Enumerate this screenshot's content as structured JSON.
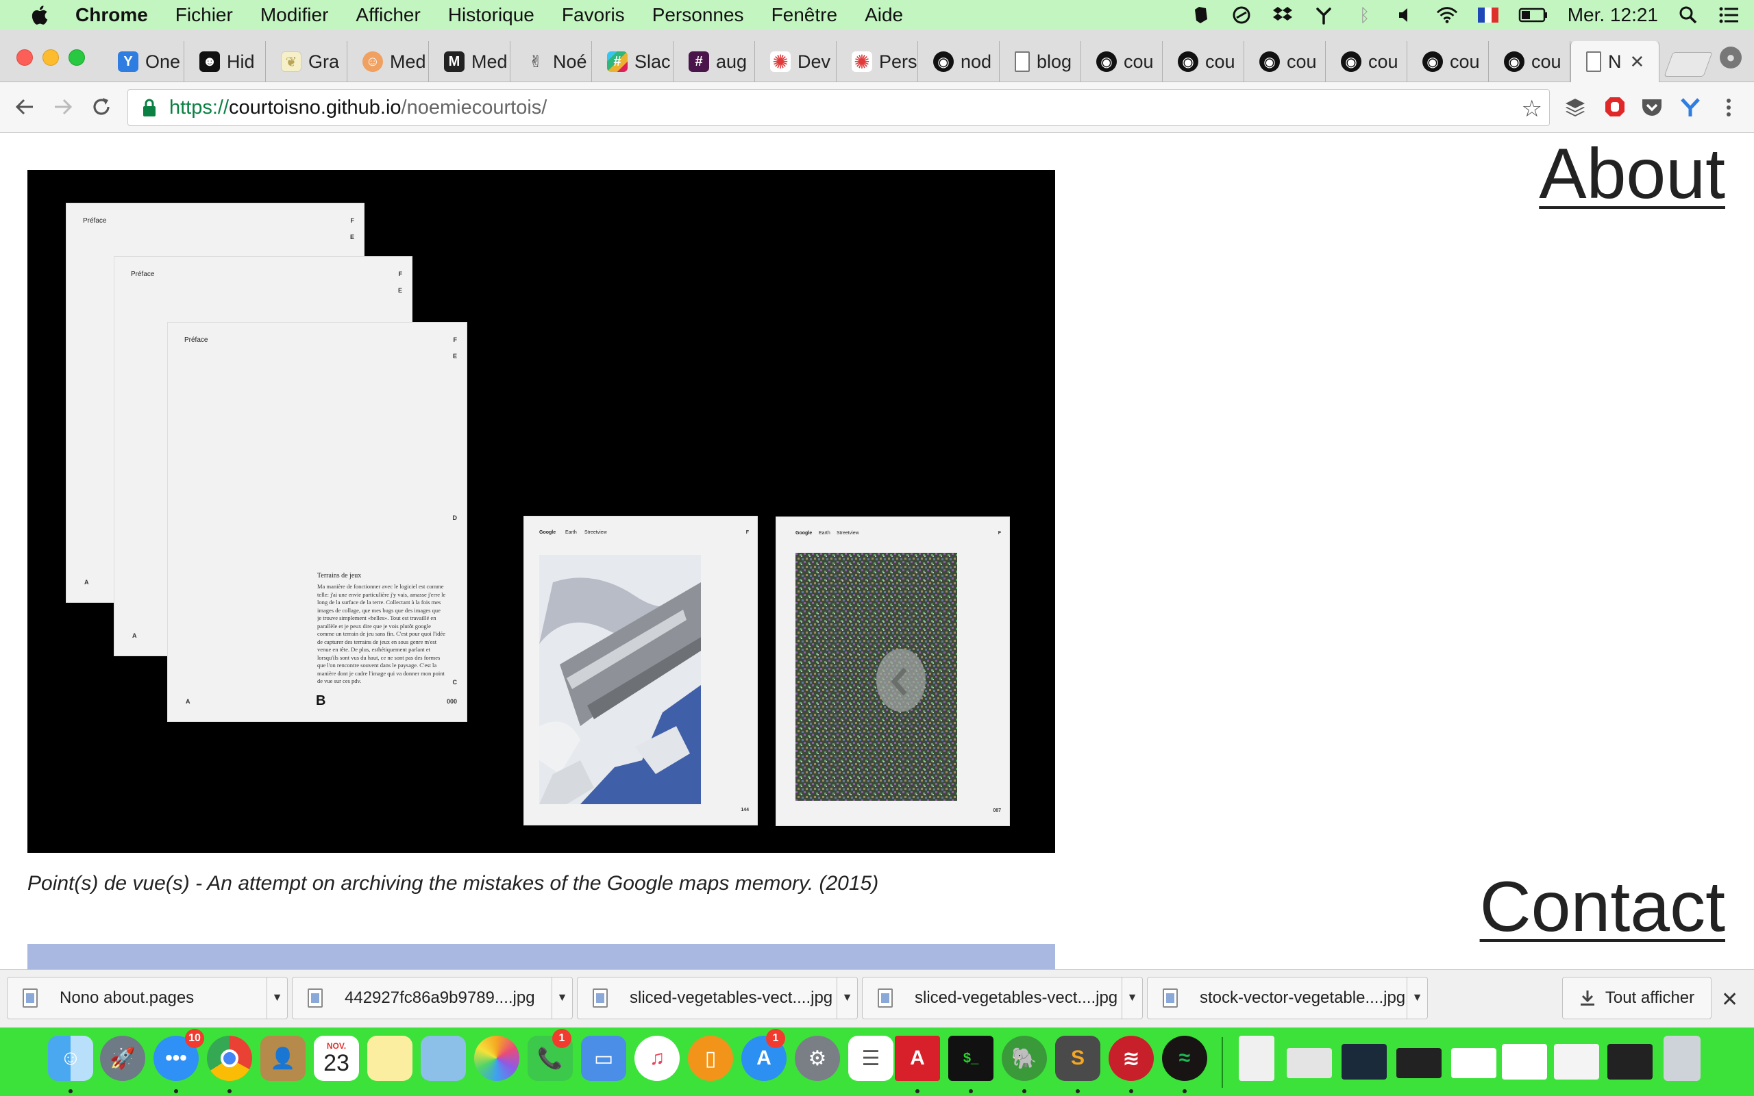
{
  "menubar": {
    "app_name": "Chrome",
    "items": [
      "Fichier",
      "Modifier",
      "Afficher",
      "Historique",
      "Favoris",
      "Personnes",
      "Fenêtre",
      "Aide"
    ],
    "clock": "Mer. 12:21",
    "status_icons": [
      "evernote-icon",
      "sync-icon",
      "dropbox-icon",
      "branch-icon",
      "bluetooth-icon",
      "volume-icon",
      "wifi-icon",
      "flag-fr-icon",
      "battery-icon",
      "spotlight-icon",
      "notification-center-icon"
    ]
  },
  "tabs": [
    {
      "label": "One",
      "icon": "y-icon",
      "color": "#2f7de1"
    },
    {
      "label": "Hid",
      "icon": "face-icon",
      "color": "#111111"
    },
    {
      "label": "Gra",
      "icon": "leaf-icon",
      "color": "#f3e9b0"
    },
    {
      "label": "Med",
      "icon": "emoji-icon",
      "color": "#f0a060"
    },
    {
      "label": "Med",
      "icon": "medium-icon",
      "color": "#222222"
    },
    {
      "label": "Noé",
      "icon": "peace-icon",
      "color": "#ffffff"
    },
    {
      "label": "Slac",
      "icon": "slack-icon",
      "color": "#e01e5a"
    },
    {
      "label": "aug",
      "icon": "hash-icon",
      "color": "#4a154b"
    },
    {
      "label": "Dev",
      "icon": "gear-red-icon",
      "color": "#e03a3a"
    },
    {
      "label": "Pers",
      "icon": "gear-red-icon",
      "color": "#e03a3a"
    },
    {
      "label": "nod",
      "icon": "github-icon",
      "color": "#111111"
    },
    {
      "label": "blog",
      "icon": "page-icon",
      "color": "#ffffff"
    },
    {
      "label": "cou",
      "icon": "github-icon",
      "color": "#111111"
    },
    {
      "label": "cou",
      "icon": "github-icon",
      "color": "#111111"
    },
    {
      "label": "cou",
      "icon": "github-icon",
      "color": "#111111"
    },
    {
      "label": "cou",
      "icon": "github-icon",
      "color": "#111111"
    },
    {
      "label": "cou",
      "icon": "github-icon",
      "color": "#111111"
    },
    {
      "label": "cou",
      "icon": "github-icon",
      "color": "#111111"
    }
  ],
  "active_tab": {
    "label": "N",
    "icon": "page-icon"
  },
  "address": {
    "protocol": "https://",
    "host": "courtoisno.github.io",
    "path": "/noemiecourtois/"
  },
  "toolbar_extensions": [
    "buffer-icon",
    "adblock-icon",
    "pocket-icon",
    "y-extension-icon",
    "menu-dots-icon"
  ],
  "page": {
    "nav_about": "About",
    "nav_contact": "Contact",
    "caption": "Point(s) de vue(s) - An attempt on archiving the mistakes of the Google maps memory. (2015)",
    "hero_sheets": {
      "preface_label": "Préface",
      "side_letters": [
        "F",
        "E",
        "D",
        "C"
      ],
      "corner_a": "A",
      "corner_b": "B",
      "page_num": "000",
      "spread_header": [
        "Google",
        "Earth",
        "Streetview"
      ],
      "spread_nums": [
        "144",
        "087"
      ],
      "body_title": "Terrains de jeux",
      "body_text": "Ma manière de fonctionner avec le logiciel est comme telle: j'ai une envie particulière j'y vais, amasse j'erre le long de la surface de la terre. Collectant à la fois mes images de collage, que mes bugs que des images que je trouve simplement «belles». Tout est travaillé en parallèle et je peux dire que je vois plutôt google comme un terrain de jeu sans fin. C'est pour quoi l'idée de capturer des terrains de jeux en sous genre m'est venue en tête. De plus, esthétiquement parlant et lorsqu'ils sont vus du haut, ce ne sont pas des formes que l'on rencontre souvent dans le paysage. C'est la manière dont je cadre l'image qui va donner mon point de vue sur ces pdv."
    }
  },
  "downloads": [
    {
      "name": "Nono about.pages"
    },
    {
      "name": "442927fc86a9b9789....jpg"
    },
    {
      "name": "sliced-vegetables-vect....jpg"
    },
    {
      "name": "sliced-vegetables-vect....jpg"
    },
    {
      "name": "stock-vector-vegetable....jpg"
    }
  ],
  "show_all_label": "Tout afficher",
  "dock": {
    "calendar_month": "NOV.",
    "calendar_day": "23",
    "messages_badge": "10",
    "facetime_badge": "1",
    "appstore_badge": "1",
    "apps": [
      "finder-icon",
      "launchpad-icon",
      "messages-icon",
      "chrome-icon",
      "contacts-icon",
      "calendar-icon",
      "notes-icon",
      "preview-icon",
      "photos-icon",
      "facetime-icon",
      "keynote-icon",
      "itunes-icon",
      "ibooks-icon",
      "appstore-icon",
      "system-preferences-icon",
      "reminders-icon",
      "acrobat-icon",
      "terminal-icon",
      "evernote-icon",
      "sublime-text-icon",
      "buffer-app-icon",
      "spotify-icon"
    ]
  },
  "colors": {
    "menubar": "#c3f5c0",
    "dock": "#3ce23a",
    "hero_bg": "#000000",
    "next_project": "#a8b8e0",
    "url_protocol": "#0b8043"
  }
}
